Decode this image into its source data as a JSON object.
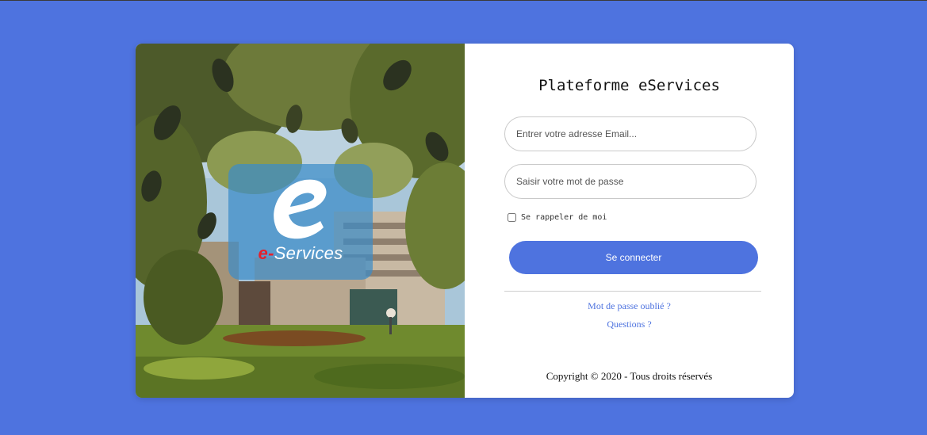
{
  "colors": {
    "background": "#4e73df",
    "button": "#4e73df",
    "link": "#4e73df",
    "card": "#ffffff"
  },
  "logo": {
    "brand_prefix": "e-",
    "brand_name": "Services",
    "mark": "e"
  },
  "login": {
    "title": "Plateforme eServices",
    "email_placeholder": "Entrer votre adresse Email...",
    "password_placeholder": "Saisir votre mot de passe",
    "remember_label": "Se rappeler de moi",
    "remember_checked": false,
    "submit_label": "Se connecter",
    "forgot_link": "Mot de passe oublié ?",
    "questions_link": "Questions ?"
  },
  "footer": {
    "copyright": "Copyright © 2020 - Tous droits réservés"
  }
}
